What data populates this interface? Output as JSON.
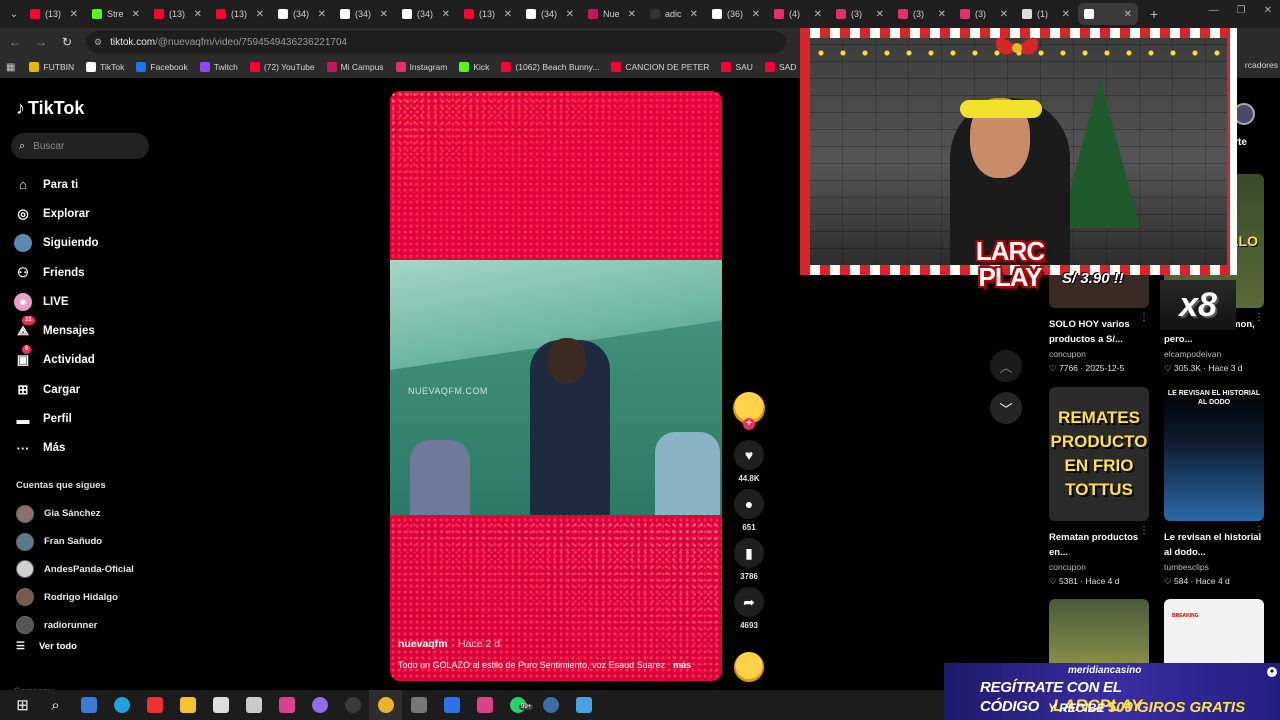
{
  "browser": {
    "tabs": [
      {
        "label": "(13)",
        "color": "#ff0033",
        "active": false
      },
      {
        "label": "Stre",
        "color": "#53fc18",
        "active": false
      },
      {
        "label": "(13)",
        "color": "#ff0033",
        "active": false
      },
      {
        "label": "(13)",
        "color": "#ff0033",
        "active": false
      },
      {
        "label": "(34)",
        "color": "#ffffff",
        "active": false
      },
      {
        "label": "(34)",
        "color": "#ffffff",
        "active": false
      },
      {
        "label": "(34)",
        "color": "#ffffff",
        "active": false
      },
      {
        "label": "(13)",
        "color": "#ff0033",
        "active": false
      },
      {
        "label": "(34)",
        "color": "#ffffff",
        "active": false
      },
      {
        "label": "Nue",
        "color": "#c2185b",
        "active": false
      },
      {
        "label": "adic",
        "color": "#333333",
        "active": false
      },
      {
        "label": "(36)",
        "color": "#ffffff",
        "active": false
      },
      {
        "label": "(4)",
        "color": "#e1306c",
        "active": false
      },
      {
        "label": "(3)",
        "color": "#e1306c",
        "active": false
      },
      {
        "label": "(3)",
        "color": "#e1306c",
        "active": false
      },
      {
        "label": "(3)",
        "color": "#e1306c",
        "active": false
      },
      {
        "label": "(1)",
        "color": "#dddddd",
        "active": false
      },
      {
        "label": "",
        "color": "#ffffff",
        "active": true
      }
    ],
    "url_host": "tiktok.com",
    "url_path": "/@nuevaqfm/video/7594549436236221704",
    "bookmarks": [
      {
        "label": "FUTBIN",
        "color": "#e6b800"
      },
      {
        "label": "TikTok",
        "color": "#ffffff"
      },
      {
        "label": "Facebook",
        "color": "#1877f2"
      },
      {
        "label": "Twitch",
        "color": "#9146ff"
      },
      {
        "label": "(72) YouTube",
        "color": "#ff0033"
      },
      {
        "label": "Mi Campus",
        "color": "#c2185b"
      },
      {
        "label": "Instagram",
        "color": "#e1306c"
      },
      {
        "label": "Kick",
        "color": "#53fc18"
      },
      {
        "label": "(1062) Beach Bunny...",
        "color": "#ff0033"
      },
      {
        "label": "CANCION DE PETER",
        "color": "#ff0033"
      },
      {
        "label": "SAU",
        "color": "#ff0033"
      },
      {
        "label": "SAD",
        "color": "#ff0033"
      },
      {
        "label": "(463)",
        "color": "#ff0033"
      }
    ],
    "bookmarks_right": "rcadores"
  },
  "sidebar": {
    "logo": "TikTok",
    "search_placeholder": "Buscar",
    "nav": [
      {
        "label": "Para ti",
        "icon": "home-icon",
        "glyph": "⌂"
      },
      {
        "label": "Explorar",
        "icon": "compass-icon",
        "glyph": "◎"
      },
      {
        "label": "Siguiendo",
        "icon": "following-avatar-icon",
        "glyph": "●"
      },
      {
        "label": "Friends",
        "icon": "friends-icon",
        "glyph": "⚇"
      },
      {
        "label": "LIVE",
        "icon": "live-icon",
        "glyph": "◉"
      },
      {
        "label": "Mensajes",
        "icon": "messages-icon",
        "glyph": "⟁",
        "badge": "31"
      },
      {
        "label": "Actividad",
        "icon": "activity-icon",
        "glyph": "▣",
        "badge": "6"
      },
      {
        "label": "Cargar",
        "icon": "upload-icon",
        "glyph": "⊞"
      },
      {
        "label": "Perfil",
        "icon": "profile-icon",
        "glyph": "▬"
      },
      {
        "label": "Más",
        "icon": "more-icon",
        "glyph": "···"
      }
    ],
    "following_title": "Cuentas que sigues",
    "following": [
      {
        "name": "Gia Sánchez",
        "color": "#8a7070"
      },
      {
        "name": "Fran Sañudo",
        "color": "#5a7a8a"
      },
      {
        "name": "AndesPanda-Oficial",
        "color": "#d0d0d0"
      },
      {
        "name": "Rodrigo Hidalgo",
        "color": "#7a5a4a"
      },
      {
        "name": "radiorunner",
        "color": "#555555"
      }
    ],
    "see_all": "Ver todo",
    "company": "Company"
  },
  "video": {
    "watermark": "NUEVAQFM.COM",
    "author": "nuevaqfm",
    "when": "· Hace 2 d",
    "caption": "Todo un GOLAZO al estilo de Puro Sentimiento, voz Esaud Suarez",
    "more": "más"
  },
  "actions": {
    "likes": "44.8K",
    "comments": "651",
    "saves": "3786",
    "shares": "4693"
  },
  "stream_overlay": {
    "logo_line1": "LARC",
    "logo_line2": "PLAY",
    "price": "S/ 3.90 !!",
    "multiplier": "x8"
  },
  "right_column": {
    "top_button": "sarte",
    "cards": [
      {
        "title": "SOLO HOY varios productos a S/...",
        "user": "concupon",
        "likes": "7766",
        "date": "2025-12-5",
        "thumb_text": "",
        "thumb_bg": "#3a2a25"
      },
      {
        "title": "...os gusta el jamon, pero...",
        "user": "elcampodeivan",
        "likes": "305.3K",
        "date": "Hace 3 d",
        "thumb_text": "ios ALO",
        "thumb_bg": "#2e3a1e"
      },
      {
        "title": "Rematan productos en...",
        "user": "concupon",
        "likes": "5381",
        "date": "Hace 4 d",
        "thumb_text": "REMATES PRODUCTO EN FRIO TOTTUS",
        "thumb_bg": "#2a2a2a"
      },
      {
        "title": "Le revisan el historial al dodo...",
        "user": "tumbesclips",
        "likes": "584",
        "date": "Hace 4 d",
        "thumb_text": "LE REVISAN EL HISTORIAL AL DODO",
        "thumb_bg": "#0e1a2e"
      },
      {
        "title": "",
        "user": "",
        "likes": "",
        "date": "",
        "thumb_text": "",
        "thumb_bg": "#3a4a2a"
      },
      {
        "title": "",
        "user": "",
        "likes": "",
        "date": "",
        "thumb_text": "BREAKING",
        "thumb_bg": "#f2f2f2"
      }
    ]
  },
  "casino_banner": {
    "brand": "meridiancasino",
    "line1": "REGÍTRATE CON EL CÓDIGO",
    "code": "LARCPLAY",
    "line2_prefix": "Y RECIBE",
    "line2_bonus": "500 GIROS GRATIS"
  },
  "taskbar": {
    "chat_badge": "99+",
    "items": [
      {
        "icon": "windows-start-icon",
        "color": "#ffffff"
      },
      {
        "icon": "search-icon",
        "color": "#ffffff"
      },
      {
        "icon": "store-icon",
        "color": "#3a7bd5"
      },
      {
        "icon": "edge-icon",
        "color": "#1fa1e0"
      },
      {
        "icon": "youtube-app-icon",
        "color": "#e33"
      },
      {
        "icon": "folder-icon",
        "color": "#f1c232"
      },
      {
        "icon": "app-icon",
        "color": "#dddddd"
      },
      {
        "icon": "app-icon-2",
        "color": "#c9c9c9"
      },
      {
        "icon": "app-icon-3",
        "color": "#d9438b"
      },
      {
        "icon": "discord-icon",
        "color": "#8d6ee6"
      },
      {
        "icon": "obs-icon",
        "color": "#3a3a3a"
      },
      {
        "icon": "chrome-icon",
        "color": "#e9b52b"
      },
      {
        "icon": "calculator-icon",
        "color": "#777777"
      },
      {
        "icon": "word-icon",
        "color": "#2b73e6"
      },
      {
        "icon": "app-icon-4",
        "color": "#d9438b"
      },
      {
        "icon": "whatsapp-icon",
        "color": "#25d366"
      },
      {
        "icon": "steam-icon",
        "color": "#3a6ea5"
      },
      {
        "icon": "photos-icon",
        "color": "#4aa3e0"
      }
    ]
  }
}
